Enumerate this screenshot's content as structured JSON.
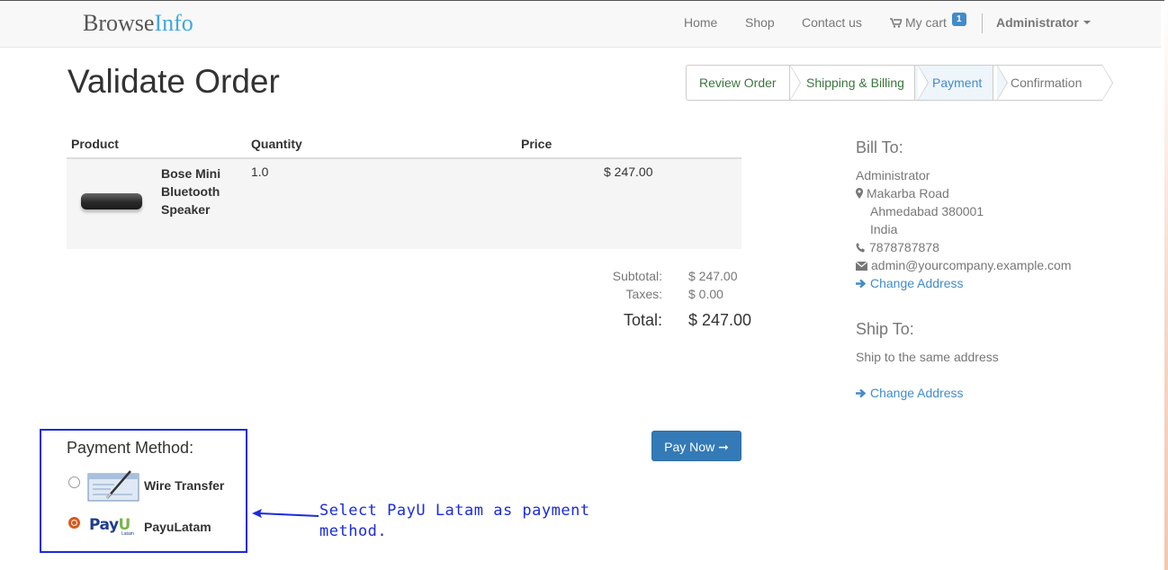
{
  "brand": {
    "part1": "Browse",
    "part2": "Info"
  },
  "nav": {
    "home": "Home",
    "shop": "Shop",
    "contact": "Contact us",
    "cart": "My cart",
    "cart_count": "1",
    "user": "Administrator"
  },
  "page": {
    "title": "Validate Order"
  },
  "wizard": {
    "steps": [
      {
        "label": "Review Order",
        "state": "done"
      },
      {
        "label": "Shipping & Billing",
        "state": "done"
      },
      {
        "label": "Payment",
        "state": "active"
      },
      {
        "label": "Confirmation",
        "state": "todo"
      }
    ]
  },
  "table": {
    "headers": {
      "product": "Product",
      "quantity": "Quantity",
      "price": "Price"
    },
    "rows": [
      {
        "name_line1": "Bose Mini",
        "name_line2": "Bluetooth",
        "name_line3": "Speaker",
        "quantity": "1.0",
        "price": "$ 247.00"
      }
    ]
  },
  "totals": {
    "subtotal_label": "Subtotal:",
    "subtotal": "$ 247.00",
    "taxes_label": "Taxes:",
    "taxes": "$ 0.00",
    "total_label": "Total:",
    "total": "$ 247.00"
  },
  "bill_to": {
    "heading": "Bill To:",
    "name": "Administrator",
    "street": "Makarba Road",
    "city": "Ahmedabad 380001",
    "country": "India",
    "phone": "7878787878",
    "email": "admin@yourcompany.example.com",
    "change": "Change Address"
  },
  "ship_to": {
    "heading": "Ship To:",
    "text": "Ship to the same address",
    "change": "Change Address"
  },
  "payment": {
    "title": "Payment Method:",
    "methods": [
      {
        "label": "Wire Transfer",
        "selected": false
      },
      {
        "label": "PayuLatam",
        "selected": true
      }
    ],
    "payu_logo_main": "PAYU",
    "payu_logo_sub": "Latam",
    "pay_now": "Pay Now ➞"
  },
  "annotation": {
    "line1": "Select PayU Latam as payment",
    "line2": "method."
  },
  "colors": {
    "brand_blue": "#3fa7e0",
    "link": "#428bca",
    "button": "#337ab7",
    "annotation": "#1a2bdf",
    "radio_selected": "#d9591c"
  }
}
